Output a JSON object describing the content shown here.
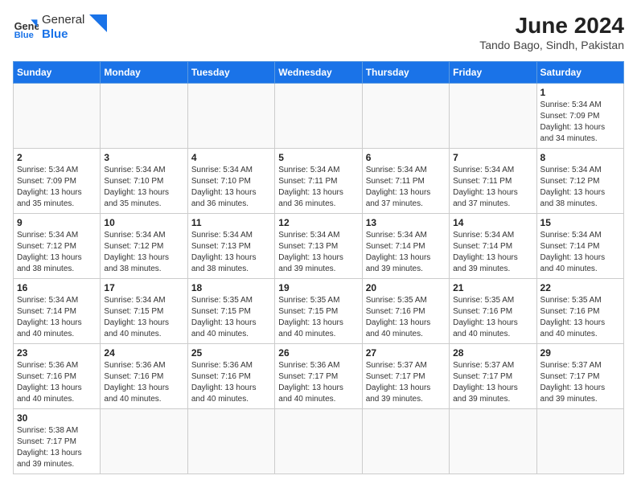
{
  "header": {
    "logo_text_normal": "General",
    "logo_text_bold": "Blue",
    "title": "June 2024",
    "subtitle": "Tando Bago, Sindh, Pakistan"
  },
  "weekdays": [
    "Sunday",
    "Monday",
    "Tuesday",
    "Wednesday",
    "Thursday",
    "Friday",
    "Saturday"
  ],
  "weeks": [
    [
      null,
      null,
      null,
      null,
      null,
      null,
      {
        "day": 1,
        "sunrise": "5:34 AM",
        "sunset": "7:09 PM",
        "daylight": "13 hours and 34 minutes."
      }
    ],
    [
      {
        "day": 2,
        "sunrise": "5:34 AM",
        "sunset": "7:09 PM",
        "daylight": "13 hours and 35 minutes."
      },
      {
        "day": 3,
        "sunrise": "5:34 AM",
        "sunset": "7:10 PM",
        "daylight": "13 hours and 35 minutes."
      },
      {
        "day": 4,
        "sunrise": "5:34 AM",
        "sunset": "7:10 PM",
        "daylight": "13 hours and 36 minutes."
      },
      {
        "day": 5,
        "sunrise": "5:34 AM",
        "sunset": "7:11 PM",
        "daylight": "13 hours and 36 minutes."
      },
      {
        "day": 6,
        "sunrise": "5:34 AM",
        "sunset": "7:11 PM",
        "daylight": "13 hours and 37 minutes."
      },
      {
        "day": 7,
        "sunrise": "5:34 AM",
        "sunset": "7:11 PM",
        "daylight": "13 hours and 37 minutes."
      },
      {
        "day": 8,
        "sunrise": "5:34 AM",
        "sunset": "7:12 PM",
        "daylight": "13 hours and 38 minutes."
      }
    ],
    [
      {
        "day": 9,
        "sunrise": "5:34 AM",
        "sunset": "7:12 PM",
        "daylight": "13 hours and 38 minutes."
      },
      {
        "day": 10,
        "sunrise": "5:34 AM",
        "sunset": "7:12 PM",
        "daylight": "13 hours and 38 minutes."
      },
      {
        "day": 11,
        "sunrise": "5:34 AM",
        "sunset": "7:13 PM",
        "daylight": "13 hours and 38 minutes."
      },
      {
        "day": 12,
        "sunrise": "5:34 AM",
        "sunset": "7:13 PM",
        "daylight": "13 hours and 39 minutes."
      },
      {
        "day": 13,
        "sunrise": "5:34 AM",
        "sunset": "7:14 PM",
        "daylight": "13 hours and 39 minutes."
      },
      {
        "day": 14,
        "sunrise": "5:34 AM",
        "sunset": "7:14 PM",
        "daylight": "13 hours and 39 minutes."
      },
      {
        "day": 15,
        "sunrise": "5:34 AM",
        "sunset": "7:14 PM",
        "daylight": "13 hours and 40 minutes."
      }
    ],
    [
      {
        "day": 16,
        "sunrise": "5:34 AM",
        "sunset": "7:14 PM",
        "daylight": "13 hours and 40 minutes."
      },
      {
        "day": 17,
        "sunrise": "5:34 AM",
        "sunset": "7:15 PM",
        "daylight": "13 hours and 40 minutes."
      },
      {
        "day": 18,
        "sunrise": "5:35 AM",
        "sunset": "7:15 PM",
        "daylight": "13 hours and 40 minutes."
      },
      {
        "day": 19,
        "sunrise": "5:35 AM",
        "sunset": "7:15 PM",
        "daylight": "13 hours and 40 minutes."
      },
      {
        "day": 20,
        "sunrise": "5:35 AM",
        "sunset": "7:16 PM",
        "daylight": "13 hours and 40 minutes."
      },
      {
        "day": 21,
        "sunrise": "5:35 AM",
        "sunset": "7:16 PM",
        "daylight": "13 hours and 40 minutes."
      },
      {
        "day": 22,
        "sunrise": "5:35 AM",
        "sunset": "7:16 PM",
        "daylight": "13 hours and 40 minutes."
      }
    ],
    [
      {
        "day": 23,
        "sunrise": "5:36 AM",
        "sunset": "7:16 PM",
        "daylight": "13 hours and 40 minutes."
      },
      {
        "day": 24,
        "sunrise": "5:36 AM",
        "sunset": "7:16 PM",
        "daylight": "13 hours and 40 minutes."
      },
      {
        "day": 25,
        "sunrise": "5:36 AM",
        "sunset": "7:16 PM",
        "daylight": "13 hours and 40 minutes."
      },
      {
        "day": 26,
        "sunrise": "5:36 AM",
        "sunset": "7:17 PM",
        "daylight": "13 hours and 40 minutes."
      },
      {
        "day": 27,
        "sunrise": "5:37 AM",
        "sunset": "7:17 PM",
        "daylight": "13 hours and 39 minutes."
      },
      {
        "day": 28,
        "sunrise": "5:37 AM",
        "sunset": "7:17 PM",
        "daylight": "13 hours and 39 minutes."
      },
      {
        "day": 29,
        "sunrise": "5:37 AM",
        "sunset": "7:17 PM",
        "daylight": "13 hours and 39 minutes."
      }
    ],
    [
      {
        "day": 30,
        "sunrise": "5:38 AM",
        "sunset": "7:17 PM",
        "daylight": "13 hours and 39 minutes."
      },
      null,
      null,
      null,
      null,
      null,
      null
    ]
  ]
}
